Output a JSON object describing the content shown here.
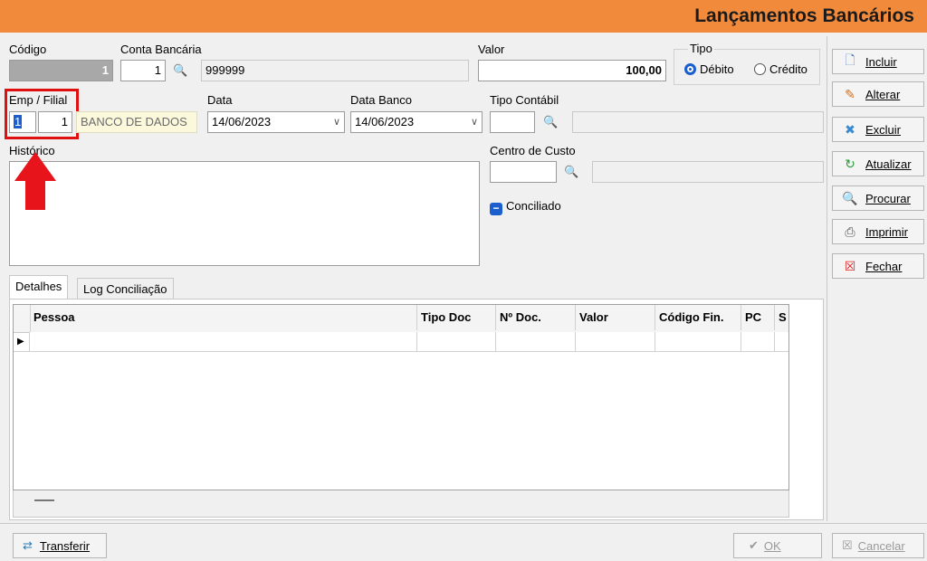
{
  "header": {
    "title": "Lançamentos Bancários"
  },
  "form": {
    "codigo_label": "Código",
    "codigo_value": "1",
    "conta_label": "Conta Bancária",
    "conta_code": "1",
    "conta_name": "999999",
    "valor_label": "Valor",
    "valor_value": "100,00",
    "tipo_label": "Tipo",
    "tipo_debito": "Débito",
    "tipo_credito": "Crédito",
    "emp_filial_label": "Emp / Filial",
    "emp_value": "1",
    "filial_value": "1",
    "emp_name": "BANCO DE DADOS",
    "data_label": "Data",
    "data_value": "14/06/2023",
    "data_banco_label": "Data Banco",
    "data_banco_value": "14/06/2023",
    "tipo_contabil_label": "Tipo Contábil",
    "centro_custo_label": "Centro de Custo",
    "historico_label": "Histórico",
    "conciliado_label": "Conciliado"
  },
  "tabs": [
    {
      "label": "Detalhes"
    },
    {
      "label": "Log Conciliação"
    }
  ],
  "grid": {
    "columns": [
      "Pessoa",
      "Tipo Doc",
      "Nº Doc.",
      "Valor",
      "Código Fin.",
      "PC",
      "S"
    ]
  },
  "sidebar": {
    "incluir": "Incluir",
    "alterar": "Alterar",
    "excluir": "Excluir",
    "atualizar": "Atualizar",
    "procurar": "Procurar",
    "imprimir": "Imprimir",
    "fechar": "Fechar"
  },
  "bottom": {
    "transferir": "Transferir",
    "ok": "OK",
    "cancelar": "Cancelar"
  },
  "colors": {
    "header": "#f28a3c",
    "highlight": "#e01010",
    "accent": "#1b5fcf"
  }
}
